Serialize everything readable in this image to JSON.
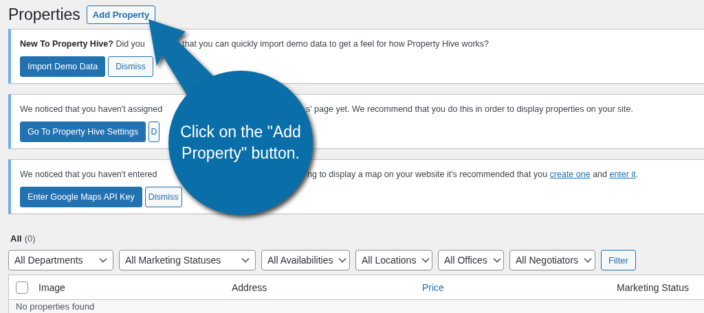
{
  "page": {
    "title": "Properties",
    "add_button": "Add Property"
  },
  "notices": [
    {
      "before": [
        {
          "kind": "bold",
          "text": "New To Property Hive?"
        },
        {
          "kind": "text",
          "text": " Did you"
        }
      ],
      "after": [
        {
          "kind": "text",
          "text": "that you can quickly import demo data to get a feel for how Property Hive works?"
        }
      ],
      "buttons": [
        {
          "kind": "primary",
          "label": "Import Demo Data"
        },
        {
          "kind": "secondary",
          "label": "Dismiss"
        }
      ]
    },
    {
      "before": [
        {
          "kind": "text",
          "text": "We noticed that you haven't assigned"
        }
      ],
      "after": [
        {
          "kind": "text",
          "text": "s' page yet. We recommend that you do this in order to display properties on your site."
        }
      ],
      "buttons": [
        {
          "kind": "primary",
          "label": "Go To Property Hive Settings"
        },
        {
          "kind": "secondary",
          "label": "D"
        }
      ]
    },
    {
      "before": [
        {
          "kind": "text",
          "text": "We noticed that you haven't entered"
        }
      ],
      "after": [
        {
          "kind": "text",
          "text": "ng to display a map on your website it's recommended that you "
        },
        {
          "kind": "link",
          "text": "create one"
        },
        {
          "kind": "text",
          "text": " and "
        },
        {
          "kind": "link",
          "text": "enter it"
        },
        {
          "kind": "text",
          "text": "."
        }
      ],
      "buttons": [
        {
          "kind": "primary",
          "label": "Enter Google Maps API Key"
        },
        {
          "kind": "secondary",
          "label": "Dismiss"
        }
      ]
    }
  ],
  "views": [
    {
      "label": "All",
      "count": "(0)",
      "selected": true
    }
  ],
  "filters": [
    "All Departments",
    "All Marketing Statuses",
    "All Availabilities",
    "All Locations",
    "All Offices",
    "All Negotiators"
  ],
  "filter_button": "Filter",
  "table": {
    "select_all_checked": false,
    "columns": [
      {
        "label": "Image",
        "kind": "plain"
      },
      {
        "label": "Address",
        "kind": "plain"
      },
      {
        "label": "Price",
        "kind": "sortable"
      },
      {
        "label": "Marketing Status",
        "kind": "plain"
      }
    ],
    "empty_message": "No properties found"
  },
  "callout": {
    "text": "Click on the \"Add Property\" button."
  }
}
